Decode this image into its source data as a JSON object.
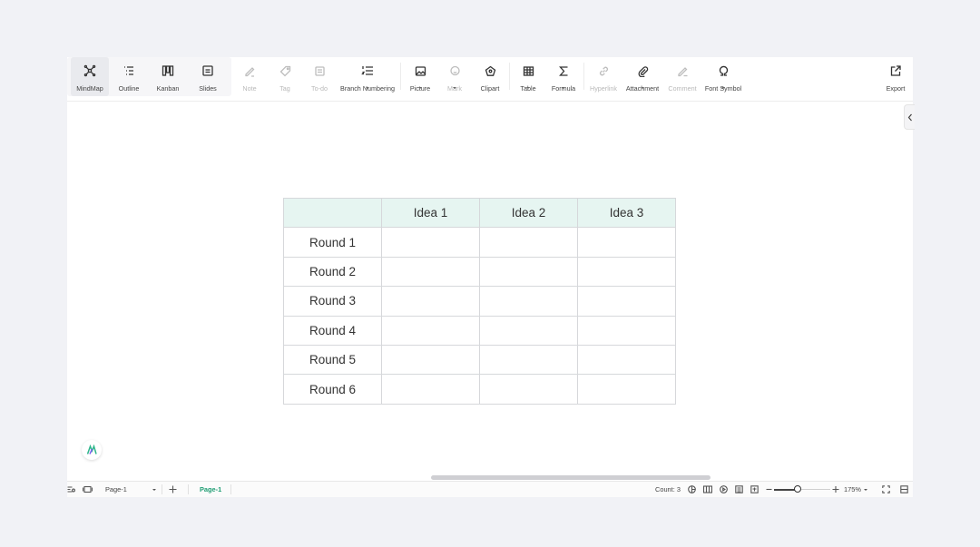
{
  "toolbar": {
    "views": [
      {
        "label": "MindMap",
        "icon": "mindmap-icon",
        "active": true
      },
      {
        "label": "Outline",
        "icon": "outline-icon",
        "active": false
      },
      {
        "label": "Kanban",
        "icon": "kanban-icon",
        "active": false
      },
      {
        "label": "Slides",
        "icon": "slides-icon",
        "active": false
      }
    ],
    "tools": [
      {
        "label": "Note",
        "icon": "note-icon",
        "disabled": true
      },
      {
        "label": "Tag",
        "icon": "tag-icon",
        "disabled": true
      },
      {
        "label": "To-do",
        "icon": "todo-icon",
        "disabled": true
      },
      {
        "label": "Branch Numbering",
        "icon": "branch-numbering-icon",
        "disabled": false
      },
      {
        "label": "Picture",
        "icon": "picture-icon",
        "disabled": false
      },
      {
        "label": "Mark",
        "icon": "mark-icon",
        "disabled": true
      },
      {
        "label": "Clipart",
        "icon": "clipart-icon",
        "disabled": false
      },
      {
        "label": "Table",
        "icon": "table-icon",
        "disabled": false
      },
      {
        "label": "Formula",
        "icon": "formula-icon",
        "disabled": false
      },
      {
        "label": "Hyperlink",
        "icon": "hyperlink-icon",
        "disabled": true
      },
      {
        "label": "Attachment",
        "icon": "attachment-icon",
        "disabled": false
      },
      {
        "label": "Comment",
        "icon": "comment-icon",
        "disabled": true
      },
      {
        "label": "Font Symbol",
        "icon": "font-symbol-icon",
        "disabled": false
      }
    ],
    "export_label": "Export"
  },
  "table": {
    "header": [
      "",
      "Idea 1",
      "Idea 2",
      "Idea 3"
    ],
    "rows": [
      [
        "Round 1",
        "",
        "",
        ""
      ],
      [
        "Round 2",
        "",
        "",
        ""
      ],
      [
        "Round 3",
        "",
        "",
        ""
      ],
      [
        "Round 4",
        "",
        "",
        ""
      ],
      [
        "Round 5",
        "",
        "",
        ""
      ],
      [
        "Round 6",
        "",
        "",
        ""
      ]
    ],
    "header_bg": "#e6f5f1"
  },
  "status": {
    "page_select": "Page-1",
    "page_tab": "Page-1",
    "count": "Count: 3",
    "zoom": "175%",
    "zoom_level": 0.42,
    "accent": "#1f9d73"
  }
}
